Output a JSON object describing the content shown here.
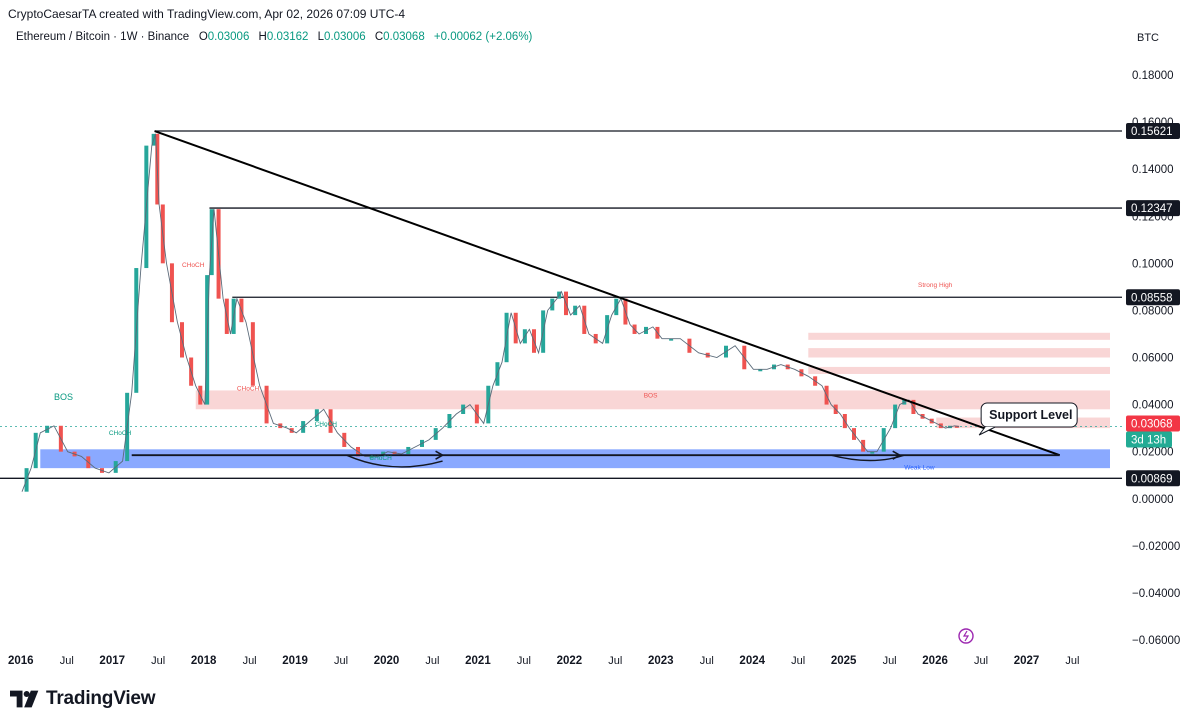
{
  "header": {
    "attribution": "CryptoCaesarTA created with TradingView.com, Apr 02, 2026 07:09 UTC-4"
  },
  "symbol": {
    "title": "Ethereum / Bitcoin · 1W · Binance",
    "o_label": "O",
    "o_value": "0.03006",
    "h_label": "H",
    "h_value": "0.03162",
    "l_label": "L",
    "l_value": "0.03006",
    "c_label": "C",
    "c_value": "0.03068",
    "change": "+0.00062 (+2.06%)",
    "currency": "BTC"
  },
  "brand": {
    "name": "TradingView"
  },
  "colors": {
    "up": "#26a69a",
    "down": "#ef5350",
    "support_zone": "#2962ff",
    "resistance_zone": "#f7c8c8",
    "trendline": "#000000",
    "price_label": "#f23645",
    "countdown_label": "#22ab94"
  },
  "chart_data": {
    "type": "line",
    "title": "Ethereum / Bitcoin · 1W · Binance",
    "ylim": [
      -0.065,
      0.19
    ],
    "yticks": [
      "0.18000",
      "0.16000",
      "0.14000",
      "0.12000",
      "0.10000",
      "0.08000",
      "0.06000",
      "0.04000",
      "0.02000",
      "0.00000",
      "−0.02000",
      "−0.04000",
      "−0.06000"
    ],
    "ytick_values": [
      0.18,
      0.16,
      0.14,
      0.12,
      0.1,
      0.08,
      0.06,
      0.04,
      0.02,
      0.0,
      -0.02,
      -0.04,
      -0.06
    ],
    "xlim": [
      2016.0,
      2027.9
    ],
    "xticks": [
      "2016",
      "Jul",
      "2017",
      "Jul",
      "2018",
      "Jul",
      "2019",
      "Jul",
      "2020",
      "Jul",
      "2021",
      "Jul",
      "2022",
      "Jul",
      "2023",
      "Jul",
      "2024",
      "Jul",
      "2025",
      "Jul",
      "2026",
      "Jul",
      "2027",
      "Jul"
    ],
    "xtick_values": [
      2016.0,
      2016.5,
      2017.0,
      2017.5,
      2018.0,
      2018.5,
      2019.0,
      2019.5,
      2020.0,
      2020.5,
      2021.0,
      2021.5,
      2022.0,
      2022.5,
      2023.0,
      2023.5,
      2024.0,
      2024.5,
      2025.0,
      2025.5,
      2026.0,
      2026.5,
      2027.0,
      2027.5
    ],
    "series": [
      {
        "values_x": [
          2016.0,
          2016.1,
          2016.2,
          2016.35,
          2016.5,
          2016.65,
          2016.8,
          2016.95,
          2017.1,
          2017.2,
          2017.3,
          2017.42,
          2017.46,
          2017.5,
          2017.58,
          2017.7,
          2017.8,
          2017.9,
          2018.0,
          2018.05,
          2018.1,
          2018.2,
          2018.28,
          2018.35,
          2018.45,
          2018.6,
          2018.75,
          2018.9,
          2019.0,
          2019.15,
          2019.3,
          2019.45,
          2019.6,
          2019.75,
          2019.9,
          2020.0,
          2020.15,
          2020.3,
          2020.45,
          2020.6,
          2020.75,
          2020.9,
          2021.05,
          2021.15,
          2021.25,
          2021.35,
          2021.45,
          2021.55,
          2021.65,
          2021.75,
          2021.85,
          2021.9,
          2022.0,
          2022.1,
          2022.2,
          2022.35,
          2022.45,
          2022.55,
          2022.65,
          2022.75,
          2022.9,
          2023.0,
          2023.2,
          2023.4,
          2023.6,
          2023.8,
          2024.0,
          2024.15,
          2024.3,
          2024.45,
          2024.6,
          2024.75,
          2024.85,
          2024.95,
          2025.05,
          2025.15,
          2025.25,
          2025.35,
          2025.5,
          2025.6,
          2025.7,
          2025.8,
          2025.9,
          2026.0,
          2026.1,
          2026.2,
          2026.25
        ],
        "values_y": [
          0.003,
          0.013,
          0.028,
          0.031,
          0.02,
          0.018,
          0.013,
          0.011,
          0.016,
          0.045,
          0.098,
          0.15,
          0.155,
          0.125,
          0.1,
          0.075,
          0.06,
          0.048,
          0.04,
          0.095,
          0.123,
          0.085,
          0.07,
          0.085,
          0.075,
          0.048,
          0.032,
          0.03,
          0.028,
          0.033,
          0.038,
          0.028,
          0.022,
          0.018,
          0.018,
          0.02,
          0.019,
          0.022,
          0.025,
          0.03,
          0.036,
          0.04,
          0.032,
          0.048,
          0.058,
          0.079,
          0.066,
          0.072,
          0.062,
          0.08,
          0.085,
          0.088,
          0.078,
          0.082,
          0.07,
          0.066,
          0.078,
          0.085,
          0.074,
          0.07,
          0.073,
          0.068,
          0.068,
          0.062,
          0.06,
          0.065,
          0.055,
          0.055,
          0.057,
          0.055,
          0.052,
          0.048,
          0.04,
          0.036,
          0.03,
          0.025,
          0.02,
          0.02,
          0.03,
          0.04,
          0.042,
          0.036,
          0.034,
          0.032,
          0.03,
          0.031,
          0.03068
        ]
      }
    ],
    "horizontal_levels": [
      {
        "value": 0.15621,
        "label": "0.15621"
      },
      {
        "value": 0.12347,
        "label": "0.12347"
      },
      {
        "value": 0.08558,
        "label": "0.08558"
      },
      {
        "value": 0.00869,
        "label": "0.00869"
      }
    ],
    "current_price": {
      "value": 0.03068,
      "label": "0.03068",
      "countdown": "3d 13h"
    },
    "trendline": {
      "from": [
        2017.45,
        0.1562
      ],
      "to": [
        2027.35,
        0.0185
      ]
    },
    "zones": [
      {
        "kind": "support",
        "x_from": 2016.2,
        "x_to": 2027.9,
        "y_from": 0.013,
        "y_to": 0.021
      },
      {
        "kind": "resistance",
        "x_from": 2017.9,
        "x_to": 2027.9,
        "y_from": 0.038,
        "y_to": 0.046
      },
      {
        "kind": "resistance",
        "x_from": 2024.6,
        "x_to": 2027.9,
        "y_from": 0.0675,
        "y_to": 0.0705
      },
      {
        "kind": "resistance",
        "x_from": 2024.6,
        "x_to": 2027.9,
        "y_from": 0.06,
        "y_to": 0.064
      },
      {
        "kind": "resistance",
        "x_from": 2024.6,
        "x_to": 2027.9,
        "y_from": 0.053,
        "y_to": 0.056
      },
      {
        "kind": "resistance",
        "x_from": 2026.0,
        "x_to": 2027.9,
        "y_from": 0.03,
        "y_to": 0.0345
      }
    ],
    "annotations": [
      {
        "text": "Support Level",
        "x": 2026.6,
        "y": 0.036
      },
      {
        "text": "BOS",
        "x": 2016.35,
        "y": 0.042
      },
      {
        "text": "BOS",
        "x": 2022.8,
        "y": 0.043
      },
      {
        "text": "Strong High",
        "x": 2025.8,
        "y": 0.09
      },
      {
        "text": "Weak Low",
        "x": 2025.65,
        "y": 0.0125
      },
      {
        "text": "CHoCH",
        "x": 2019.8,
        "y": 0.0165
      },
      {
        "text": "CHoCH",
        "x": 2016.95,
        "y": 0.027
      },
      {
        "text": "CHoCH",
        "x": 2017.75,
        "y": 0.0985
      },
      {
        "text": "CHoCH",
        "x": 2018.35,
        "y": 0.046
      },
      {
        "text": "CHoCH",
        "x": 2019.2,
        "y": 0.031
      }
    ],
    "xlabel": "",
    "ylabel": "",
    "grid": false
  }
}
